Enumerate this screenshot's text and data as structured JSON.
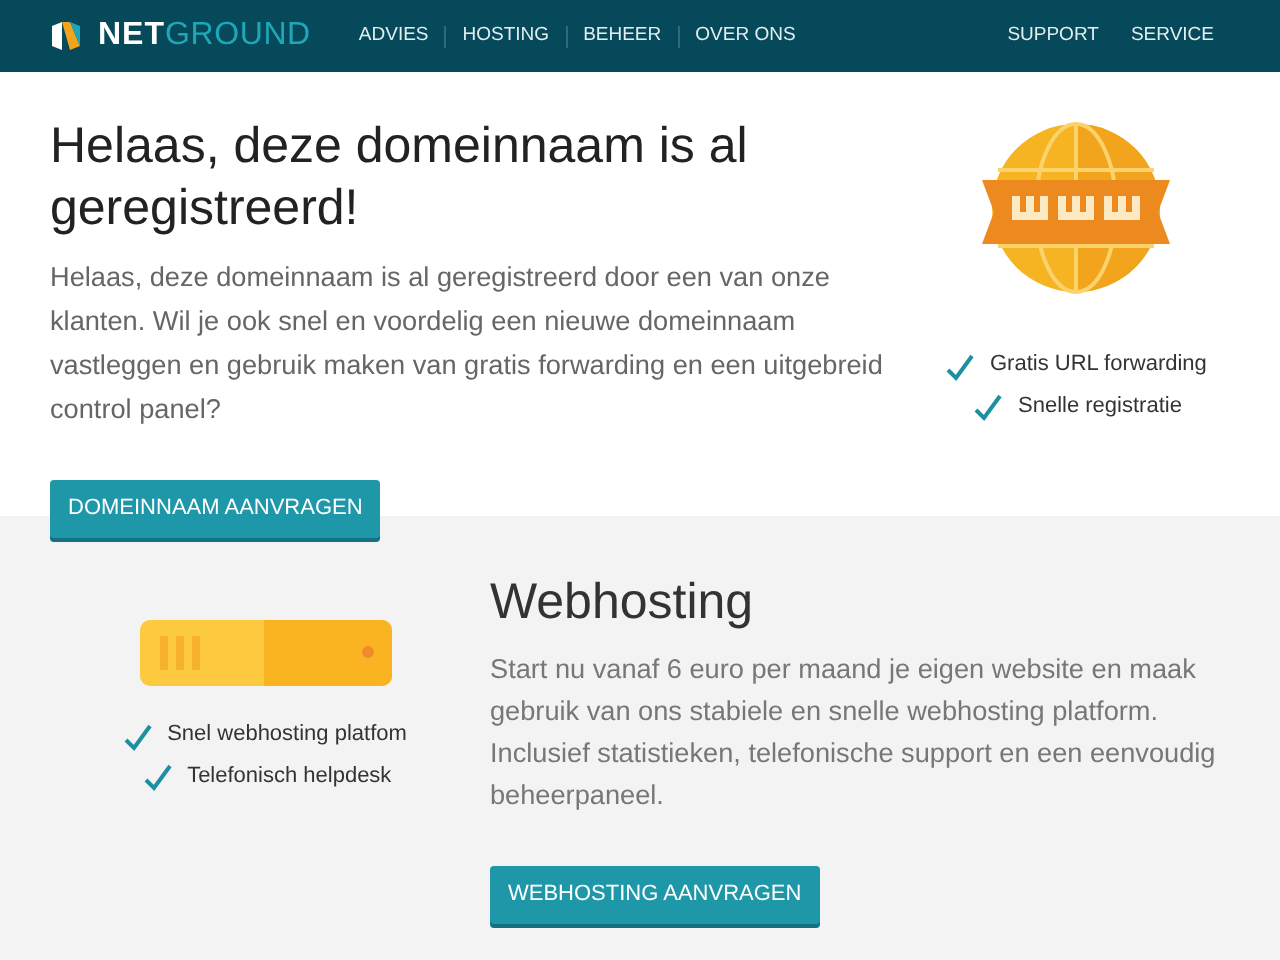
{
  "navbar": {
    "logo": {
      "first": "NET",
      "second": "GROUND"
    },
    "menu": [
      {
        "label": "ADVIES"
      },
      {
        "label": "HOSTING"
      },
      {
        "label": "BEHEER"
      },
      {
        "label": "OVER ONS"
      }
    ],
    "right_menu": [
      {
        "label": "SUPPORT"
      },
      {
        "label": "SERVICE"
      }
    ]
  },
  "hero": {
    "title": "Helaas, deze domeinnaam is al geregistreerd!",
    "text": "Helaas, deze domeinnaam is al geregistreerd door een van onze klanten. Wil je ook snel en voordelig een nieuwe domeinnaam vastleggen en gebruik maken van gratis forwarding en een uitgebreid control panel?",
    "button": "DOMEINNAAM AANVRAGEN",
    "features": [
      "Gratis URL forwarding",
      "Snelle registratie"
    ]
  },
  "hosting": {
    "features": [
      "Snel webhosting platfom",
      "Telefonisch helpdesk"
    ],
    "title": "Webhosting",
    "text": "Start nu vanaf 6 euro per maand je eigen website en maak gebruik van ons stabiele en snelle webhosting platform. Inclusief statistieken, telefonische support en een eenvoudig beheerpaneel.",
    "button": "WEBHOSTING AANVRAGEN"
  }
}
